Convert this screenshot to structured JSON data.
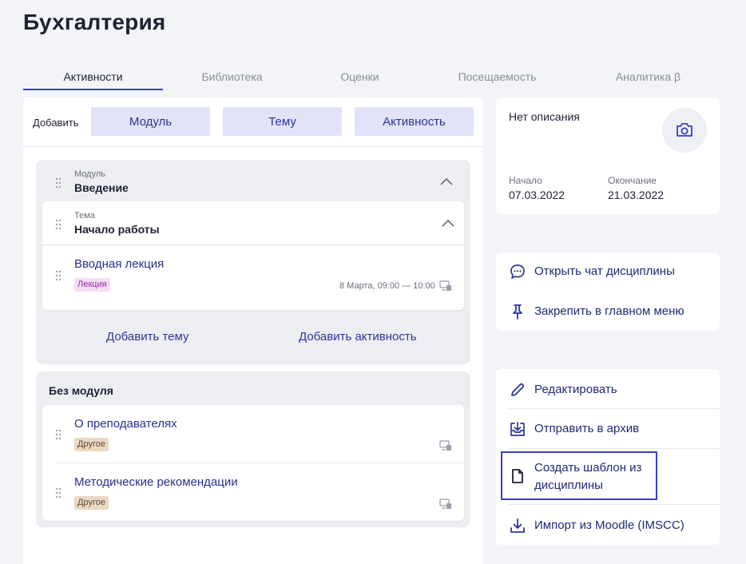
{
  "page": {
    "title": "Бухгалтерия"
  },
  "tabs": [
    {
      "label": "Активности",
      "active": true
    },
    {
      "label": "Библиотека"
    },
    {
      "label": "Оценки"
    },
    {
      "label": "Посещаемость"
    },
    {
      "label": "Аналитика β"
    }
  ],
  "add_row": {
    "label": "Добавить",
    "buttons": [
      "Модуль",
      "Тему",
      "Активность"
    ]
  },
  "module": {
    "label": "Модуль",
    "title": "Введение",
    "topic": {
      "label": "Тема",
      "title": "Начало работы",
      "activity": {
        "title": "Вводная лекция",
        "badge": "Лекция",
        "time": "8 Марта, 09:00 — 10:00"
      }
    },
    "add_topic": "Добавить тему",
    "add_activity": "Добавить активность"
  },
  "no_module": {
    "title": "Без модуля",
    "items": [
      {
        "title": "О преподавателях",
        "badge": "Другое"
      },
      {
        "title": "Методические рекомендации",
        "badge": "Другое"
      }
    ]
  },
  "info": {
    "description": "Нет описания",
    "start_label": "Начало",
    "start_value": "07.03.2022",
    "end_label": "Окончание",
    "end_value": "21.03.2022"
  },
  "actions_top": [
    "Открыть чат дисциплины",
    "Закрепить в главном меню"
  ],
  "actions_bottom": {
    "edit": "Редактировать",
    "archive": "Отправить в архив",
    "template_line1": "Создать шаблон из",
    "template_line2": "дисциплины",
    "import": "Импорт из Moodle (IMSCC)"
  },
  "colors": {
    "accent": "#3a3fc4",
    "link": "#2f349c",
    "button_bg": "#e2e3f8"
  }
}
